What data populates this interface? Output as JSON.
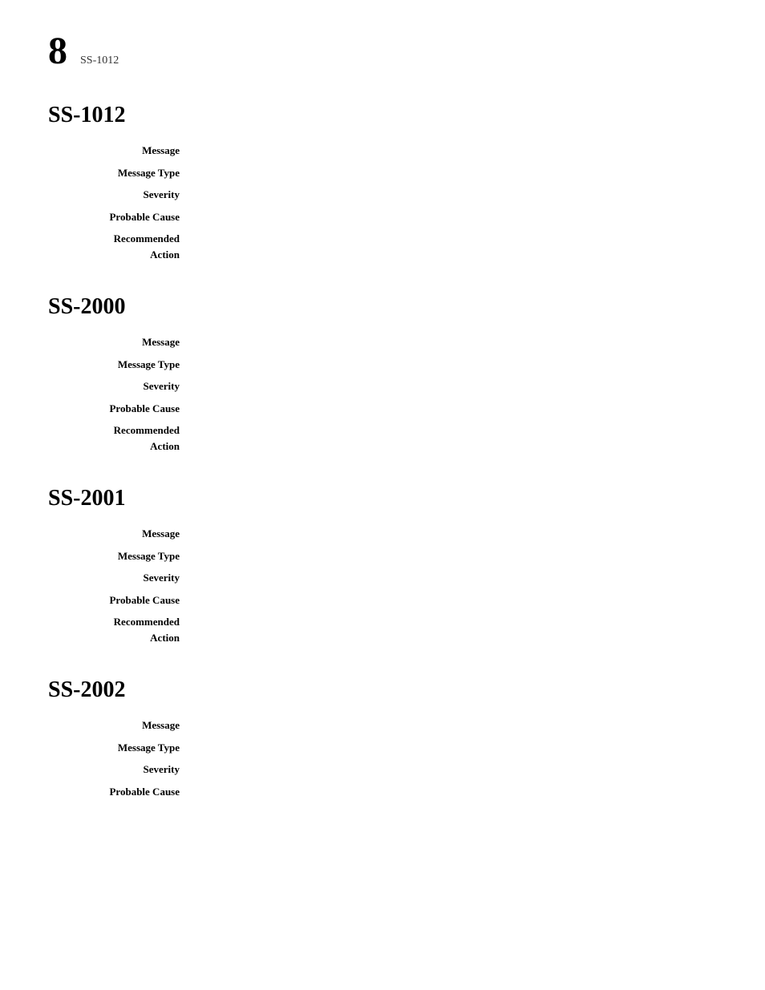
{
  "header": {
    "page_number": "8",
    "subtitle": "SS-1012"
  },
  "sections": [
    {
      "id": "ss-1012",
      "title": "SS-1012",
      "fields": [
        {
          "label": "Message",
          "value": ""
        },
        {
          "label": "Message Type",
          "value": ""
        },
        {
          "label": "Severity",
          "value": ""
        },
        {
          "label": "Probable Cause",
          "value": ""
        },
        {
          "label": "Recommended\nAction",
          "value": ""
        }
      ]
    },
    {
      "id": "ss-2000",
      "title": "SS-2000",
      "fields": [
        {
          "label": "Message",
          "value": ""
        },
        {
          "label": "Message Type",
          "value": ""
        },
        {
          "label": "Severity",
          "value": ""
        },
        {
          "label": "Probable Cause",
          "value": ""
        },
        {
          "label": "Recommended\nAction",
          "value": ""
        }
      ]
    },
    {
      "id": "ss-2001",
      "title": "SS-2001",
      "fields": [
        {
          "label": "Message",
          "value": ""
        },
        {
          "label": "Message Type",
          "value": ""
        },
        {
          "label": "Severity",
          "value": ""
        },
        {
          "label": "Probable Cause",
          "value": ""
        },
        {
          "label": "Recommended\nAction",
          "value": ""
        }
      ]
    },
    {
      "id": "ss-2002",
      "title": "SS-2002",
      "fields": [
        {
          "label": "Message",
          "value": ""
        },
        {
          "label": "Message Type",
          "value": ""
        },
        {
          "label": "Severity",
          "value": ""
        },
        {
          "label": "Probable Cause",
          "value": ""
        }
      ]
    }
  ]
}
